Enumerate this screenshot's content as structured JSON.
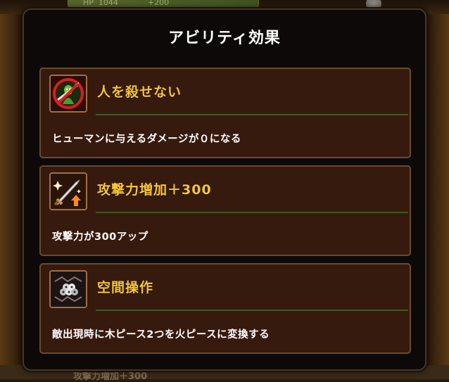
{
  "background": {
    "hp_label": "HP",
    "hp_value": "1044",
    "hp_bonus": "+200",
    "bottom_text": "攻撃力増加＋300"
  },
  "modal": {
    "title": "アビリティ効果"
  },
  "abilities": [
    {
      "name": "人を殺せない",
      "description": "ヒューマンに与えるダメージが０になる",
      "icon": "no-kill-icon"
    },
    {
      "name": "攻撃力増加＋300",
      "description": "攻撃力が300アップ",
      "icon": "sword-up-icon"
    },
    {
      "name": "空間操作",
      "description": "敵出現時に木ピース2つを火ピースに変換する",
      "icon": "space-control-icon"
    }
  ],
  "colors": {
    "ability_name": "#f7c735",
    "card_background": "#371a0e",
    "card_border": "#6a4a2a",
    "modal_background": "#0c0908",
    "divider": "#3e5a24"
  }
}
